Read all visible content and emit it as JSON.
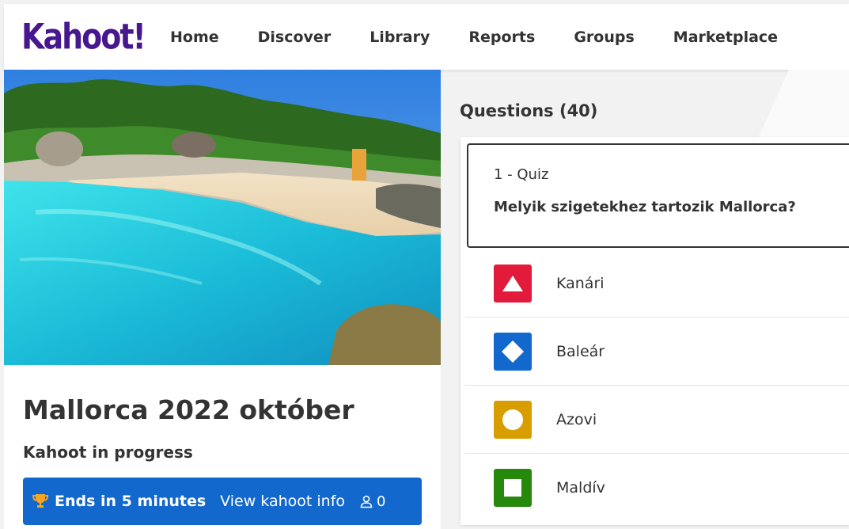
{
  "header": {
    "logo_text": "Kahoot!",
    "nav": [
      "Home",
      "Discover",
      "Library",
      "Reports",
      "Groups",
      "Marketplace"
    ]
  },
  "kahoot": {
    "title": "Mallorca 2022 október",
    "status": "Kahoot in progress",
    "ends_label": "Ends in 5 minutes",
    "view_info_label": "View kahoot info",
    "player_count": "0",
    "icons": [
      "trophy-icon",
      "user-icon"
    ]
  },
  "questions": {
    "heading": "Questions (40)",
    "first": {
      "type_label": "1 - Quiz",
      "text": "Melyik szigetekhez tartozik Mallorca?",
      "answers": [
        {
          "text": "Kanári",
          "shape": "triangle-icon",
          "color": "#e21b3c"
        },
        {
          "text": "Baleár",
          "shape": "diamond-icon",
          "color": "#1368ce"
        },
        {
          "text": "Azovi",
          "shape": "circle-icon",
          "color": "#d89e00"
        },
        {
          "text": "Maldív",
          "shape": "square-icon",
          "color": "#26890c"
        }
      ]
    }
  },
  "colors": {
    "brand_purple": "#46178f",
    "action_blue": "#1368ce",
    "red": "#e21b3c",
    "blue": "#1368ce",
    "yellow": "#d89e00",
    "green": "#26890c"
  }
}
